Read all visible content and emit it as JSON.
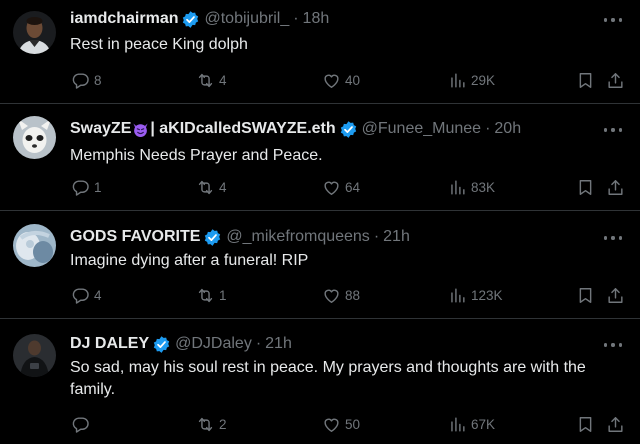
{
  "colors": {
    "background": "#000000",
    "text": "#e7e9ea",
    "muted": "#71767b",
    "verified": "#1d9bf0",
    "divider": "#2f3336"
  },
  "tweets": [
    {
      "display_name": "iamdchairman",
      "handle": "@tobijubril_",
      "time": "18h",
      "text": "Rest in peace King dolph",
      "replies": "8",
      "retweets": "4",
      "likes": "40",
      "views": "29K"
    },
    {
      "display_name": "SwayZE",
      "display_name_suffix": "| aKIDcalledSWAYZE.eth",
      "name_emoji": "smiling-devil-emoji",
      "handle": "@Funee_Munee",
      "time": "20h",
      "text": "Memphis Needs Prayer and Peace.",
      "replies": "1",
      "retweets": "4",
      "likes": "64",
      "views": "83K"
    },
    {
      "display_name": "GODS FAVORITE",
      "handle": "@_mikefromqueens",
      "time": "21h",
      "text": "Imagine dying after a funeral! RIP",
      "replies": "4",
      "retweets": "1",
      "likes": "88",
      "views": "123K"
    },
    {
      "display_name": "DJ DALEY",
      "handle": "@DJDaley",
      "time": "21h",
      "text": "So sad, may his soul rest in peace. My prayers and thoughts are with the family.",
      "replies": "",
      "retweets": "2",
      "likes": "50",
      "views": "67K"
    }
  ],
  "icons": {
    "reply": "reply-icon",
    "retweet": "retweet-icon",
    "like": "like-icon",
    "views": "views-icon",
    "bookmark": "bookmark-icon",
    "share": "share-icon",
    "more": "more-icon",
    "verified": "verified-badge-icon"
  }
}
